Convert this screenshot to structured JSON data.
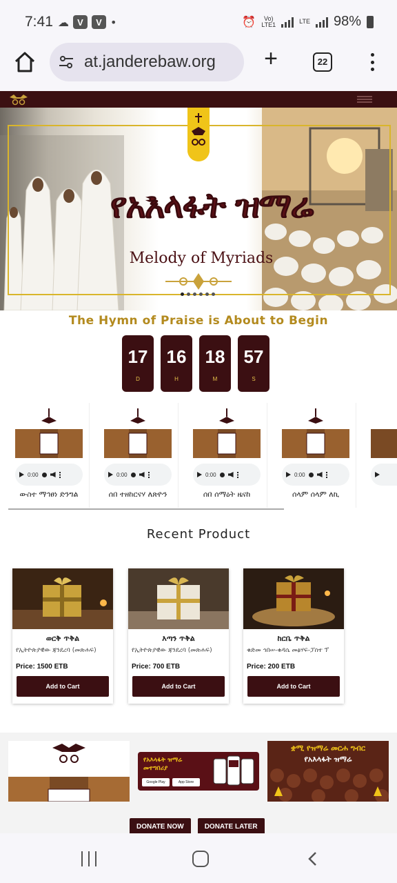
{
  "status_bar": {
    "time": "7:41",
    "volte_label": "Vo))\nLTE1",
    "lte_label": "LTE",
    "battery": "98%"
  },
  "browser": {
    "url": "at.janderebaw.org",
    "tab_count": "22"
  },
  "hero": {
    "title_amharic": "የአእላፋት ዝማሬ",
    "title_english": "Melody of Myriads",
    "slides": 6,
    "active_slide": 1
  },
  "countdown": {
    "title": "The Hymn of Praise is About to Begin",
    "units": [
      {
        "value": "17",
        "label": "D"
      },
      {
        "value": "16",
        "label": "H"
      },
      {
        "value": "18",
        "label": "M"
      },
      {
        "value": "57",
        "label": "S"
      }
    ]
  },
  "hymns": [
    {
      "title": "ውስተ ማኅፀነ ድንግል",
      "time": "0:00"
    },
    {
      "title": "ሰበ ተዘከርናሃ ለጽዮን",
      "time": "0:00"
    },
    {
      "title": "ሰበ ሰማዕት ዜናከ",
      "time": "0:00"
    },
    {
      "title": "ሰላም ሰላም ለኪ",
      "time": "0:00"
    },
    {
      "title": "",
      "time": ""
    }
  ],
  "recent_products": {
    "title": "Recent Product",
    "items": [
      {
        "name": "ወርቅ ጥቅል",
        "desc": "የኢትዮጵያዊው ጃንደረባ (መጽሐፍ)",
        "price": "Price: 1500 ETB",
        "button": "Add to Cart"
      },
      {
        "name": "እጣን ጥቅል",
        "desc": "የኢትዮጵያዊው ጃንደረባ (መጽሐፍ)",
        "price": "Price: 700 ETB",
        "button": "Add to Cart"
      },
      {
        "name": "ከርቤ ጥቅል",
        "desc": "ቁድመ ኅበሠ-ቁዳሴ መፅሃፍ-ፓስተ ፕ",
        "price": "Price: 200 ETB",
        "button": "Add to Cart"
      }
    ]
  },
  "banners": {
    "app_title": "የአእላፋት ዝማሬ መተግበሪያ",
    "store_google": "Google Play",
    "store_apple": "App Store",
    "event_heading": "ቋሚ የዝማሬ መርሐ ግብር",
    "event_title": "የአእላፋት ዝማሬ"
  },
  "donate": {
    "now": "DONATE NOW",
    "later": "DONATE LATER"
  },
  "colors": {
    "maroon": "#3b0f12",
    "gold": "#b38a1e",
    "accent_gold": "#f0c419"
  }
}
